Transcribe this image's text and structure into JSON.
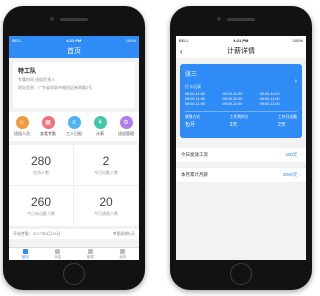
{
  "left": {
    "status": {
      "carrier": "BELL",
      "time": "4:21 PM",
      "battery": "100%"
    },
    "title": "首页",
    "team": {
      "name": "特工队",
      "sub": "专属时间 班组负责人",
      "addr": "地址信息：广东省深圳市福田区新闻路2号"
    },
    "icons": [
      {
        "label": "班组人员",
        "color": "#f39a3c",
        "icon": "people-icon"
      },
      {
        "label": "查看考勤",
        "color": "#f2717c",
        "icon": "calendar-icon"
      },
      {
        "label": "工人日报",
        "color": "#4fb2f3",
        "icon": "report-icon"
      },
      {
        "label": "计薪",
        "color": "#43c7a8",
        "icon": "money-icon"
      },
      {
        "label": "班组管理",
        "color": "#b07cf2",
        "icon": "gear-icon"
      }
    ],
    "stats": [
      {
        "num": "280",
        "label": "在场人数"
      },
      {
        "num": "2",
        "label": "今日出勤人数"
      },
      {
        "num": "260",
        "label": "今日未出勤人数"
      },
      {
        "num": "20",
        "label": "今日请假人数"
      }
    ],
    "footer_left": "开始考勤：2017年8月15日",
    "footer_right": "考勤周期1天",
    "tabs": [
      {
        "label": "首页",
        "active": true
      },
      {
        "label": "消息",
        "active": false
      },
      {
        "label": "管理",
        "active": false
      },
      {
        "label": "我的",
        "active": false
      }
    ]
  },
  "right": {
    "status": {
      "carrier": "BELL",
      "time": "4:21 PM",
      "battery": "100%"
    },
    "title": "计薪详情",
    "back": "‹",
    "card": {
      "name": "张三",
      "label": "打卡记录",
      "times": [
        "08:00-11:00",
        "09:00-11:00",
        "09:00-11:00",
        "08:00-11:00",
        "09:00-11:00",
        "09:00-11:00",
        "08:00-11:00",
        "09:00-11:00",
        "09:00-11:00"
      ],
      "bottom": [
        {
          "label": "就餐方式",
          "value": "包月"
        },
        {
          "label": "工作到时分",
          "value": "3天"
        },
        {
          "label": "工作日出勤",
          "value": "2天"
        }
      ]
    },
    "rows": [
      {
        "label": "今日发放工资",
        "value": "200元"
      },
      {
        "label": "本月累计月薪",
        "value": "3000元"
      }
    ]
  }
}
